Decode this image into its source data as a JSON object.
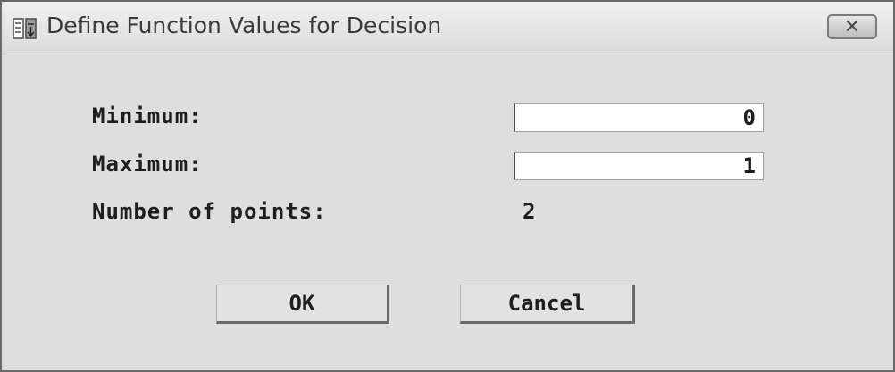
{
  "dialog": {
    "title": "Define Function Values for Decision",
    "close_glyph": "✕"
  },
  "form": {
    "minimum_label": "Minimum:",
    "minimum_value": "0",
    "maximum_label": "Maximum:",
    "maximum_value": "1",
    "points_label": "Number of points:",
    "points_value": "2"
  },
  "buttons": {
    "ok": "OK",
    "cancel": "Cancel"
  },
  "icons": {
    "app": "window-app-icon",
    "close": "close-icon"
  }
}
